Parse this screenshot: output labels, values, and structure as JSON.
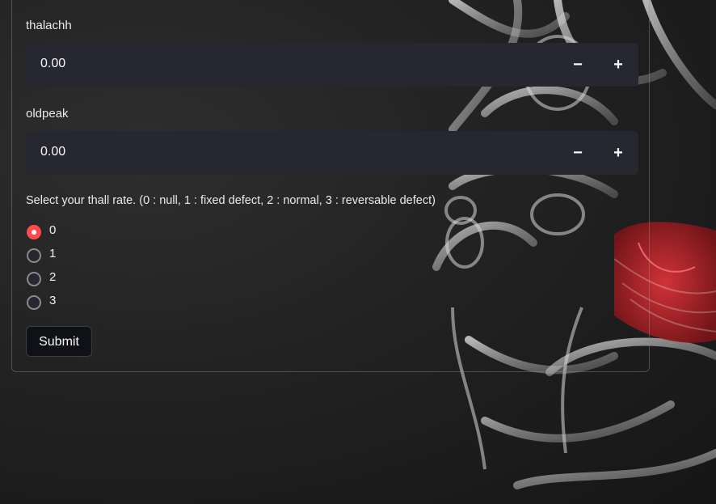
{
  "fields": [
    {
      "label": "thalachh",
      "value": "0.00",
      "minus": "−",
      "plus": "+"
    },
    {
      "label": "oldpeak",
      "value": "0.00",
      "minus": "−",
      "plus": "+"
    }
  ],
  "thall": {
    "question": "Select your thall rate. (0 : null, 1 : fixed defect, 2 : normal, 3 : reversable defect)",
    "options": [
      "0",
      "1",
      "2",
      "3"
    ],
    "selected": "0"
  },
  "submit_label": "Submit",
  "colors": {
    "accent": "#ff4b4b",
    "input_bg": "#262730",
    "heart_red": "#c8202a"
  }
}
